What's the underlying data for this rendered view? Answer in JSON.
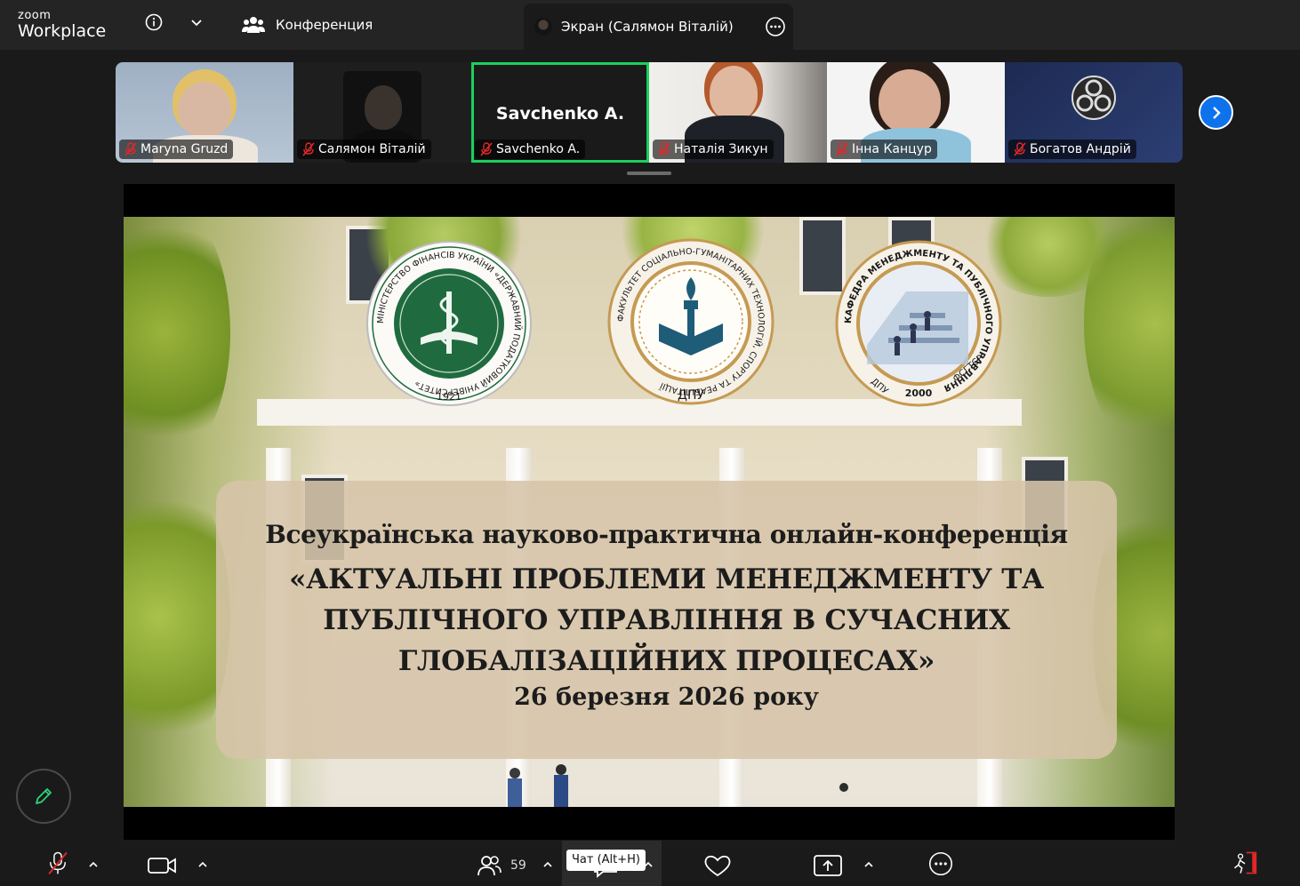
{
  "app": {
    "brand_small": "zoom",
    "brand_main": "Workplace"
  },
  "topbar": {
    "conference_tab": "Конференция",
    "screen_tab": "Экран (Салямон Віталій)"
  },
  "participants": [
    {
      "name": "Maryna Gruzd",
      "muted": true
    },
    {
      "name": "Салямон Віталій",
      "muted": true
    },
    {
      "name": "Savchenko  A.",
      "muted": true,
      "active_speaker": true,
      "big_name": "Savchenko  A."
    },
    {
      "name": "Наталія Зикун",
      "muted": true
    },
    {
      "name": "Інна Канцур",
      "muted": true
    },
    {
      "name": "Богатов Андрій",
      "muted": true
    }
  ],
  "slide": {
    "seal_left": {
      "top_text": "МІНІСТЕРСТВО ФІНАНСІВ УКРАЇНИ «ДЕРЖАВНИЙ ПОДАТКОВИЙ УНІВЕРСИТЕТ»",
      "year": "1921"
    },
    "seal_center": {
      "top_text": "ФАКУЛЬТЕТ СОЦІАЛЬНО-ГУМАНІТАРНИХ ТЕХНОЛОГІЙ, СПОРТУ ТА РЕАБІЛІТАЦІЇ",
      "bottom_text": "ДПУ"
    },
    "seal_right": {
      "top_text": "КАФЕДРА МЕНЕДЖМЕНТУ ТА ПУБЛІЧНОГО УПРАВЛІННЯ",
      "left_text": "ДПУ",
      "right_text": "ФСГТСР",
      "year": "2000"
    },
    "line1": "Всеукраїнська науково-практична онлайн-конференція",
    "title_line1": "«АКТУАЛЬНІ ПРОБЛЕМИ МЕНЕДЖМЕНТУ ТА",
    "title_line2": "ПУБЛІЧНОГО УПРАВЛІННЯ В СУЧАСНИХ",
    "title_line3": "ГЛОБАЛІЗАЦІЙНИХ ПРОЦЕСАХ»",
    "date": "26 березня 2026 року"
  },
  "toolbar": {
    "participants_count": "59",
    "chat_tooltip": "Чат (Alt+H)"
  },
  "colors": {
    "active_border": "#1ad05e",
    "accent_blue": "#0e72ed",
    "mute_red": "#e02828",
    "seal_green": "#1f6b3f",
    "seal_gold": "#c59a52"
  }
}
